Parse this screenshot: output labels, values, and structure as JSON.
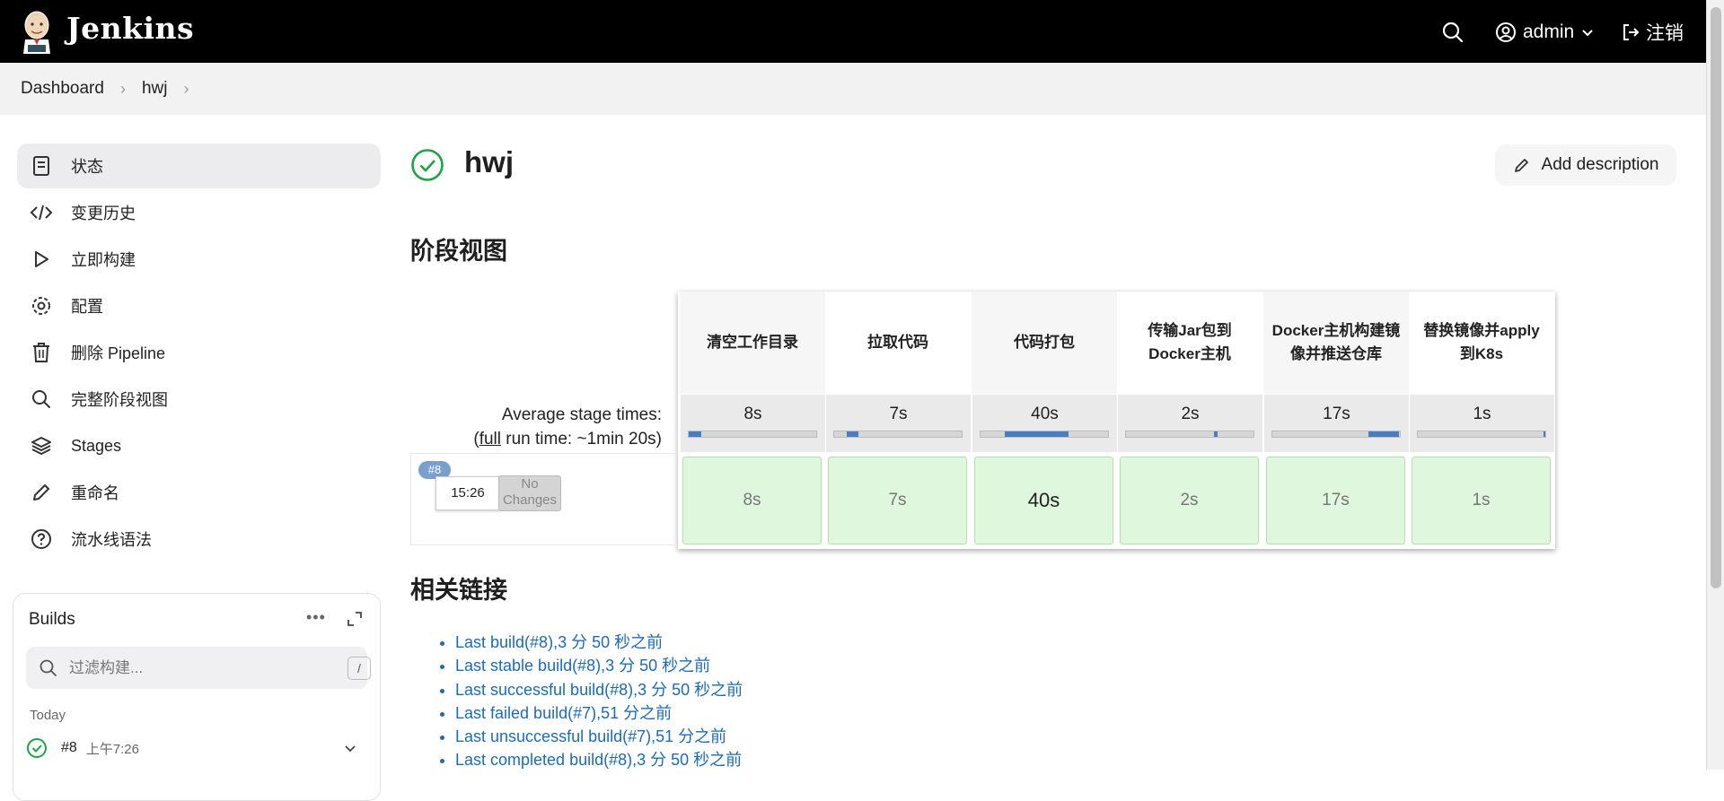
{
  "header": {
    "brand": "Jenkins",
    "user": "admin",
    "logout": "注销"
  },
  "breadcrumb": [
    "Dashboard",
    "hwj"
  ],
  "sidebar": {
    "items": [
      {
        "label": "状态",
        "icon": "status-doc-icon"
      },
      {
        "label": "变更历史",
        "icon": "code-icon"
      },
      {
        "label": "立即构建",
        "icon": "play-icon"
      },
      {
        "label": "配置",
        "icon": "gear-icon"
      },
      {
        "label": "删除 Pipeline",
        "icon": "trash-icon"
      },
      {
        "label": "完整阶段视图",
        "icon": "search-icon"
      },
      {
        "label": "Stages",
        "icon": "layers-icon"
      },
      {
        "label": "重命名",
        "icon": "pencil-icon"
      },
      {
        "label": "流水线语法",
        "icon": "help-icon"
      }
    ]
  },
  "builds": {
    "title": "Builds",
    "filter_placeholder": "过滤构建...",
    "filter_shortcut": "/",
    "group": "Today",
    "rows": [
      {
        "number": "#8",
        "time": "上午7:26",
        "status": "success"
      }
    ]
  },
  "job": {
    "title": "hwj",
    "add_description": "Add description"
  },
  "stage_view": {
    "heading": "阶段视图",
    "avg_label_line1": "Average stage times:",
    "avg_label_line2_open": "(",
    "avg_label_full": "full",
    "avg_label_line2_rest": " run time: ~1min 20s)",
    "stages": [
      {
        "name": "清空工作目录",
        "avg": "8s",
        "avg_bar_start": 0.0,
        "avg_bar_fill": 0.1
      },
      {
        "name": "拉取代码",
        "avg": "7s",
        "avg_bar_start": 0.1,
        "avg_bar_fill": 0.09
      },
      {
        "name": "代码打包",
        "avg": "40s",
        "avg_bar_start": 0.19,
        "avg_bar_fill": 0.5
      },
      {
        "name": "传输Jar包到Docker主机",
        "avg": "2s",
        "avg_bar_start": 0.69,
        "avg_bar_fill": 0.025
      },
      {
        "name": "Docker主机构建镜像并推送仓库",
        "avg": "17s",
        "avg_bar_start": 0.75,
        "avg_bar_fill": 0.24
      },
      {
        "name": "替换镜像并apply到K8s",
        "avg": "1s",
        "avg_bar_start": 0.985,
        "avg_bar_fill": 0.015
      }
    ],
    "runs": [
      {
        "badge": "#8",
        "time": "15:26",
        "changes": "No Changes",
        "durations": [
          "8s",
          "7s",
          "40s",
          "2s",
          "17s",
          "1s"
        ],
        "status": "success"
      }
    ]
  },
  "related": {
    "heading": "相关链接",
    "links": [
      "Last build(#8),3 分 50 秒之前",
      "Last stable build(#8),3 分 50 秒之前",
      "Last successful build(#8),3 分 50 秒之前",
      "Last failed build(#7),51 分之前",
      "Last unsuccessful build(#7),51 分之前",
      "Last completed build(#8),3 分 50 秒之前"
    ]
  },
  "colors": {
    "header_bg": "#000000",
    "success_green": "#1ea446",
    "link_blue": "#1d6bb5",
    "stage_success_bg": "#dff7dc",
    "avg_bar": "#4a7cc4"
  }
}
